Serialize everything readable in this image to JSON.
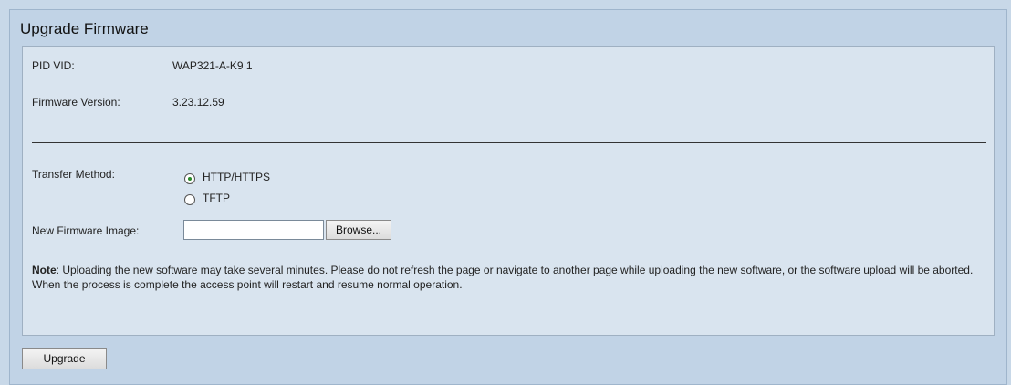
{
  "page": {
    "title": "Upgrade Firmware"
  },
  "info": {
    "pid_vid_label": "PID VID:",
    "pid_vid_value": "WAP321-A-K9 1",
    "firmware_version_label": "Firmware Version:",
    "firmware_version_value": "3.23.12.59"
  },
  "transfer": {
    "label": "Transfer Method:",
    "options": [
      {
        "label": "HTTP/HTTPS",
        "selected": true
      },
      {
        "label": "TFTP",
        "selected": false
      }
    ]
  },
  "image": {
    "label": "New Firmware Image:",
    "value": "",
    "browse_label": "Browse..."
  },
  "note": {
    "prefix": "Note",
    "text": ": Uploading the new software may take several minutes. Please do not refresh the page or navigate to another page while uploading the new software, or the software upload will be aborted. When the process is complete the access point will restart and resume normal operation."
  },
  "actions": {
    "upgrade_label": "Upgrade"
  }
}
